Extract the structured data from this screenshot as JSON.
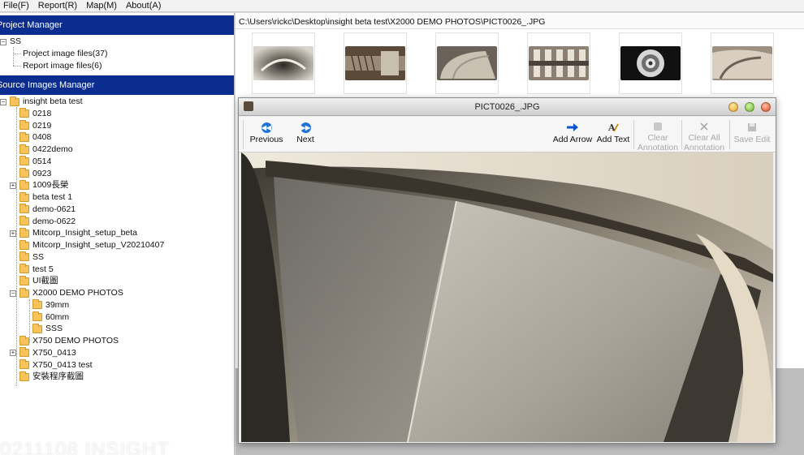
{
  "menu": [
    "File(F)",
    "Report(R)",
    "Map(M)",
    "About(A)"
  ],
  "project_manager": {
    "header": "Project Manager",
    "root": "SS",
    "items": [
      "Project image files(37)",
      "Report image files(6)"
    ]
  },
  "source_images_manager": {
    "header": "Source Images Manager",
    "root": "insight beta test",
    "folders": [
      {
        "label": "0218",
        "expandable": false
      },
      {
        "label": "0219",
        "expandable": false
      },
      {
        "label": "0408",
        "expandable": false
      },
      {
        "label": "0422demo",
        "expandable": false
      },
      {
        "label": "0514",
        "expandable": false
      },
      {
        "label": "0923",
        "expandable": false
      },
      {
        "label": "1009長榮",
        "expandable": true
      },
      {
        "label": "beta test 1",
        "expandable": false
      },
      {
        "label": "demo-0621",
        "expandable": false
      },
      {
        "label": "demo-0622",
        "expandable": false
      },
      {
        "label": "Mitcorp_Insight_setup_beta",
        "expandable": true
      },
      {
        "label": "Mitcorp_Insight_setup_V20210407",
        "expandable": false
      },
      {
        "label": "SS",
        "expandable": false
      },
      {
        "label": "test 5",
        "expandable": false
      },
      {
        "label": "UI截圖",
        "expandable": false
      },
      {
        "label": "X2000 DEMO PHOTOS",
        "expandable": true,
        "expanded": true
      },
      {
        "label": "X750 DEMO PHOTOS",
        "expandable": false
      },
      {
        "label": "X750_0413",
        "expandable": true
      },
      {
        "label": "X750_0413 test",
        "expandable": false
      },
      {
        "label": "安裝程序截圖",
        "expandable": false
      }
    ],
    "subfolders": [
      "39mm",
      "60mm",
      "SSS"
    ]
  },
  "watermark": "0211108 INSIGHT",
  "path": "C:\\Users\\rickc\\Desktop\\insight beta test\\X2000 DEMO PHOTOS\\PICT0026_.JPG",
  "thumbnails": [
    "turbine-swirl",
    "threaded-bolt",
    "curved-blade",
    "vane-row",
    "bearing-ring",
    "blade-edge"
  ],
  "viewer": {
    "title": "PICT0026_.JPG",
    "toolbar": {
      "previous": "Previous",
      "next": "Next",
      "add_arrow": "Add Arrow",
      "add_text": "Add Text",
      "clear_annotation": [
        "Clear",
        "Annotation"
      ],
      "clear_all_annotation": [
        "Clear All",
        "Annotation"
      ],
      "save_edit": "Save Edit"
    }
  },
  "colors": {
    "section_header_bg": "#0a2d8f",
    "nav_blue": "#1e73d9",
    "folder": "#f6c45a"
  }
}
